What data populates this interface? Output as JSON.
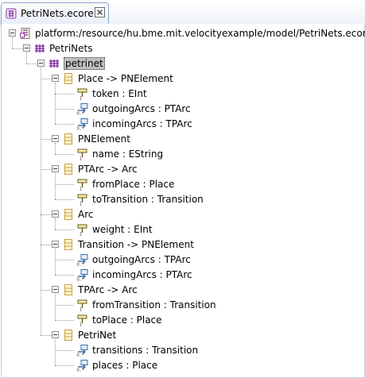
{
  "tab": {
    "title": "PetriNets.ecore",
    "close_glyph": "⊠"
  },
  "tree": {
    "root": "platform:/resource/hu.bme.mit.velocityexample/model/PetriNets.ecore",
    "package": "PetriNets",
    "subpackage": "petrinet",
    "classes": [
      {
        "label": "Place -> PNElement",
        "features": [
          {
            "label": "token : EInt",
            "kind": "attribute"
          },
          {
            "label": "outgoingArcs : PTArc",
            "kind": "reference"
          },
          {
            "label": "incomingArcs : TPArc",
            "kind": "reference"
          }
        ]
      },
      {
        "label": "PNElement",
        "features": [
          {
            "label": "name : EString",
            "kind": "attribute"
          }
        ]
      },
      {
        "label": "PTArc -> Arc",
        "features": [
          {
            "label": "fromPlace : Place",
            "kind": "attribute"
          },
          {
            "label": "toTransition : Transition",
            "kind": "attribute"
          }
        ]
      },
      {
        "label": "Arc",
        "features": [
          {
            "label": "weight : EInt",
            "kind": "attribute"
          }
        ]
      },
      {
        "label": "Transition -> PNElement",
        "features": [
          {
            "label": "outgoingArcs : TPArc",
            "kind": "reference"
          },
          {
            "label": "incomingArcs : PTArc",
            "kind": "reference"
          }
        ]
      },
      {
        "label": "TPArc -> Arc",
        "features": [
          {
            "label": "fromTransition : Transition",
            "kind": "attribute"
          },
          {
            "label": "toPlace : Place",
            "kind": "attribute"
          }
        ]
      },
      {
        "label": "PetriNet",
        "features": [
          {
            "label": "transitions : Transition",
            "kind": "reference"
          },
          {
            "label": "places : Place",
            "kind": "reference"
          }
        ]
      }
    ]
  },
  "colors": {
    "package_icon": "#8b3aa6",
    "class_icon": "#c8a23a",
    "attribute_icon": "#6b5a1e",
    "reference_icon": "#3a6ea8",
    "selection": "#c0c0c0"
  }
}
